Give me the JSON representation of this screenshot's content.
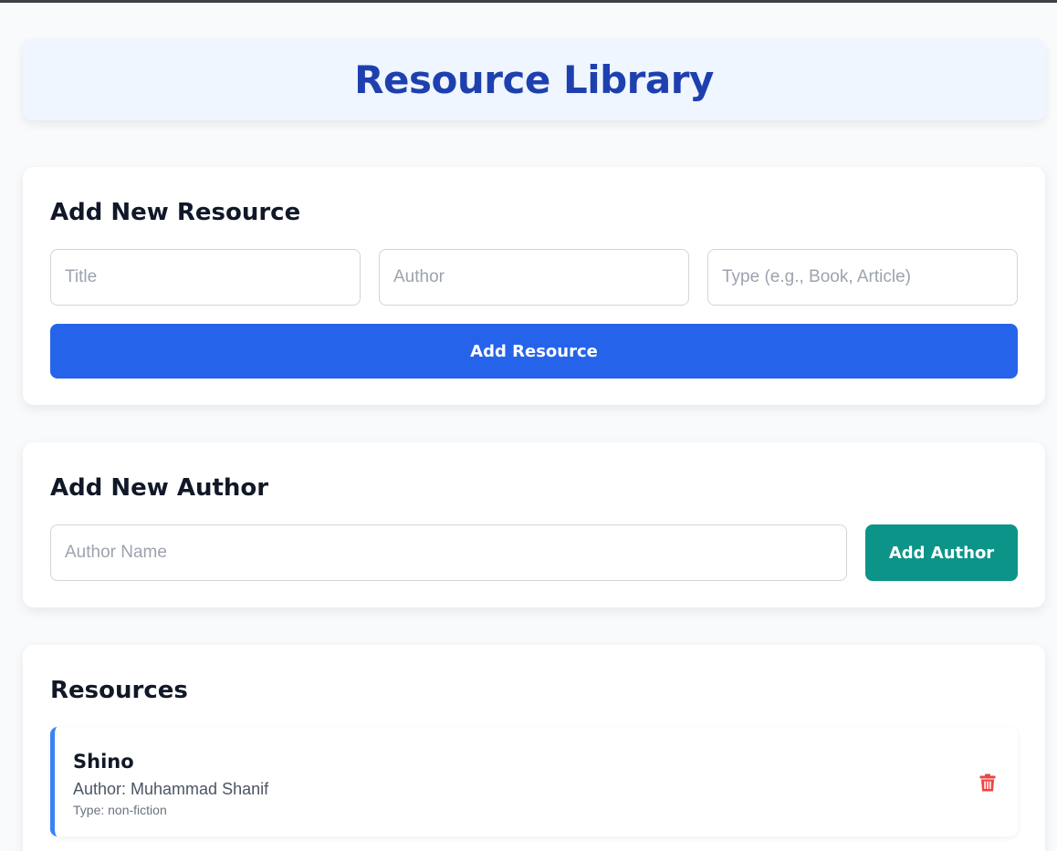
{
  "header": {
    "title": "Resource Library"
  },
  "add_resource": {
    "heading": "Add New Resource",
    "title_placeholder": "Title",
    "author_placeholder": "Author",
    "type_placeholder": "Type (e.g., Book, Article)",
    "title_value": "",
    "author_value": "",
    "type_value": "",
    "button_label": "Add Resource"
  },
  "add_author": {
    "heading": "Add New Author",
    "name_placeholder": "Author Name",
    "name_value": "",
    "button_label": "Add Author"
  },
  "resources": {
    "heading": "Resources",
    "items": [
      {
        "title": "Shino",
        "author": "Author: Muhammad Shanif",
        "type": "Type: non-fiction",
        "delete_icon": "trash-icon"
      }
    ]
  },
  "colors": {
    "header_bg": "#eff6ff",
    "header_text": "#1e40af",
    "primary_button": "#2563eb",
    "secondary_button": "#0d9488",
    "accent_border": "#3b82f6",
    "delete_icon": "#ef4444"
  }
}
